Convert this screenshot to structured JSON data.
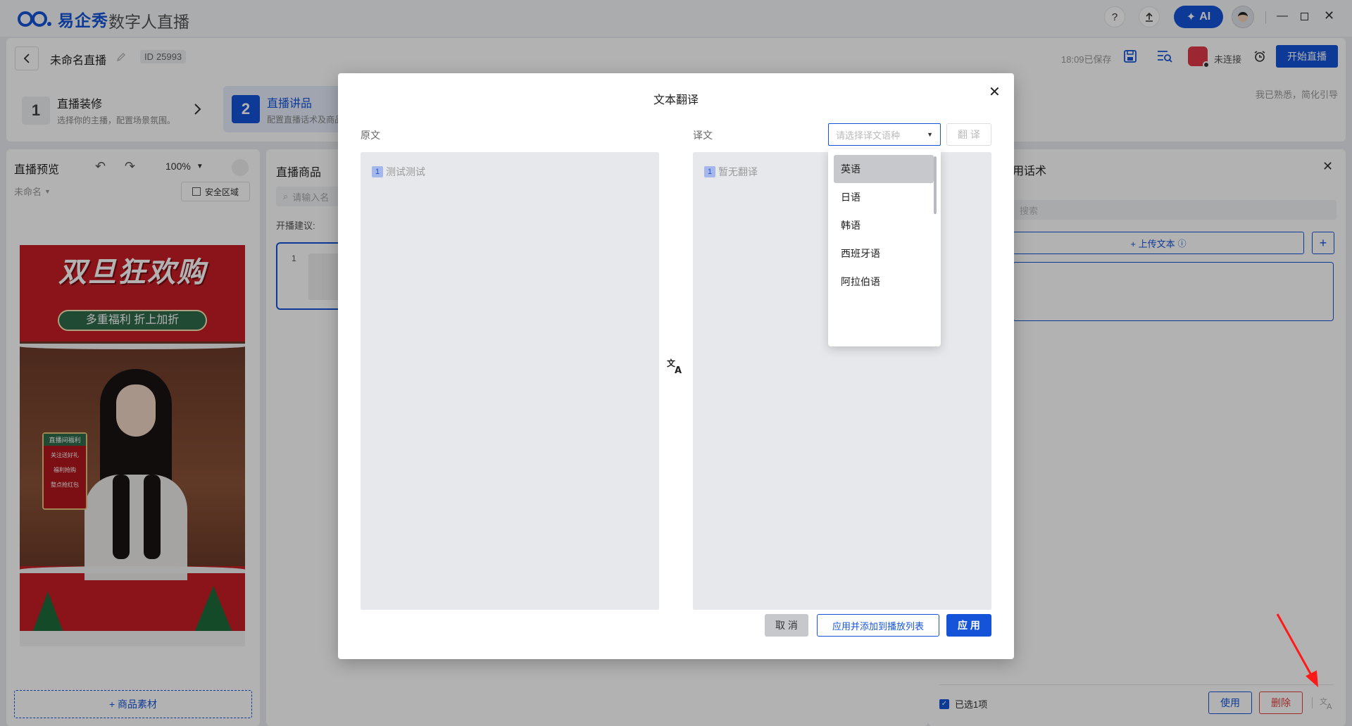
{
  "app": {
    "brand": "易企秀",
    "product": "数字人直播",
    "ai_label": "AI"
  },
  "header": {
    "title": "未命名直播",
    "id_label": "ID",
    "id_value": "25993",
    "saved_status": "18:09已保存",
    "connection_status": "未连接",
    "start_button": "开始直播",
    "hint": "我已熟悉，简化引导",
    "steps": [
      {
        "num": "1",
        "title": "直播装修",
        "desc": "选择你的主播，配置场景氛围。"
      },
      {
        "num": "2",
        "title": "直播讲品",
        "desc": "配置直播话术及商品"
      }
    ]
  },
  "preview": {
    "title": "直播预览",
    "zoom": "100%",
    "name": "未命名",
    "safe_area": "安全区域",
    "add_material": "+ 商品素材",
    "poster_title": "双旦狂欢购",
    "poster_subtitle": "多重福利  折上加折",
    "poster_sign": "直播间福利",
    "poster_items": [
      "关注送好礼",
      "福利抢购",
      "整点抢红包"
    ]
  },
  "products": {
    "title": "直播商品",
    "search_placeholder": "请输入名",
    "advice_label": "开播建议:",
    "item_index": "1"
  },
  "scripts_panel": {
    "title": "用话术",
    "search_placeholder": "搜索",
    "upload_label": "+ 上传文本",
    "selected_label": "已选1项",
    "use_button": "使用",
    "delete_button": "删除"
  },
  "modal": {
    "title": "文本翻译",
    "source_label": "原文",
    "target_label": "译文",
    "language_placeholder": "请选择译文语种",
    "translate_button": "翻 译",
    "source_lines": [
      {
        "num": "1",
        "text": "测试测试"
      }
    ],
    "target_lines": [
      {
        "num": "1",
        "text": "暂无翻译"
      }
    ],
    "language_options": [
      "英语",
      "日语",
      "韩语",
      "西班牙语",
      "阿拉伯语"
    ],
    "selected_language": "英语",
    "cancel_button": "取 消",
    "apply_add_button": "应用并添加到播放列表",
    "apply_button": "应 用"
  },
  "colors": {
    "primary": "#1554d8",
    "danger": "#e04040",
    "overlay": "rgba(0,0,0,0.30)"
  }
}
